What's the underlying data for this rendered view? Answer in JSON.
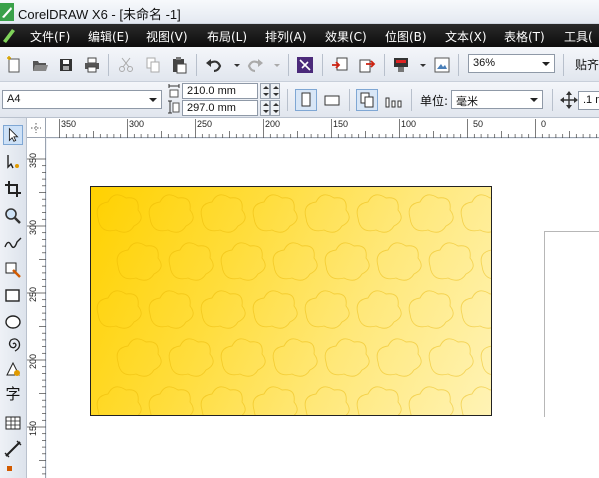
{
  "window": {
    "title": "CorelDRAW X6 - [未命名 -1]"
  },
  "menu": [
    "文件(F)",
    "编辑(E)",
    "视图(V)",
    "布局(L)",
    "排列(A)",
    "效果(C)",
    "位图(B)",
    "文本(X)",
    "表格(T)",
    "工具("
  ],
  "toolbar": {
    "zoom_value": "36%",
    "snap_label": "贴齐"
  },
  "property_bar": {
    "paper_size": "A4",
    "width": "210.0 mm",
    "height": "297.0 mm",
    "units_label": "单位:",
    "units_value": "毫米",
    "nudge_value": ".1 m"
  },
  "rulers": {
    "horizontal_ticks": [
      "350",
      "300",
      "250",
      "200",
      "150",
      "100",
      "50",
      "0"
    ],
    "vertical_ticks": [
      "350",
      "300",
      "250",
      "200",
      "150"
    ]
  },
  "toolbox": {
    "text_tool_glyph": "字"
  },
  "colors": {
    "card_gradient_start": "#ffd100",
    "card_gradient_end": "#fff3b5",
    "menu_bar": "#111111"
  }
}
